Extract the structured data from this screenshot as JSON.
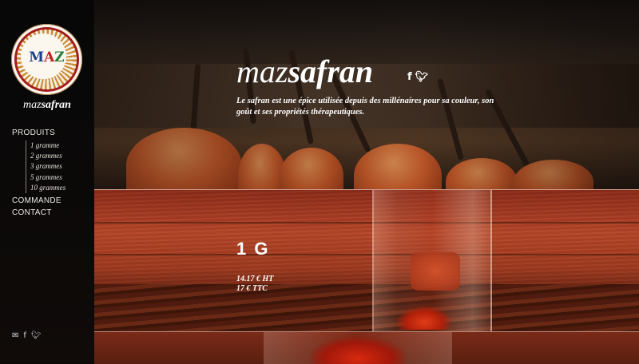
{
  "sidebar": {
    "logo_letters": [
      "M",
      "A",
      "Z"
    ],
    "brand_light": "maz",
    "brand_bold": "safran",
    "nav": {
      "produits": "PRODUITS",
      "sub_items": [
        "1 gramme",
        "2 grammes",
        "3 grammes",
        "5 grammes",
        "10 grammes"
      ],
      "commande": "COMMANDE",
      "contact": "CONTACT"
    },
    "social_icons": [
      "envelope-icon",
      "facebook-icon",
      "twitter-icon"
    ]
  },
  "hero": {
    "title_light": "maz",
    "title_bold": "safran",
    "social_icons": [
      "facebook-icon",
      "twitter-icon"
    ],
    "tagline": "Le safran est une épice utilisée depuis des millénaires pour sa couleur, son goût et ses propriétés thérapeutiques."
  },
  "product": {
    "title": "1 G",
    "price_ht": "14.17 € HT",
    "price_ttc": "17 € TTC"
  },
  "colors": {
    "sidebar_bg": "#0b0908",
    "accent_red": "#c12121",
    "logo_blue": "#1e3f8a",
    "logo_green": "#2a7d3a",
    "text": "#ffffff"
  }
}
